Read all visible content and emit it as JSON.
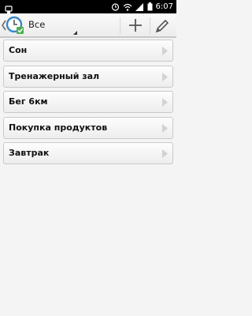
{
  "status_bar": {
    "time": "6:07"
  },
  "action_bar": {
    "filter_label": "Все",
    "add_icon": "plus-icon",
    "edit_icon": "pencil-icon"
  },
  "list": {
    "items": [
      {
        "label": "Сон"
      },
      {
        "label": "Тренажерный зал"
      },
      {
        "label": "Бег 6км"
      },
      {
        "label": "Покупка продуктов"
      },
      {
        "label": "Завтрак"
      }
    ]
  },
  "colors": {
    "status_bar_bg": "#000000",
    "action_bar_bg": "#f2f2f2",
    "list_bg": "#f4f4f4",
    "item_border": "#c9c9c9",
    "accent_icon_blue": "#3a86c8"
  }
}
